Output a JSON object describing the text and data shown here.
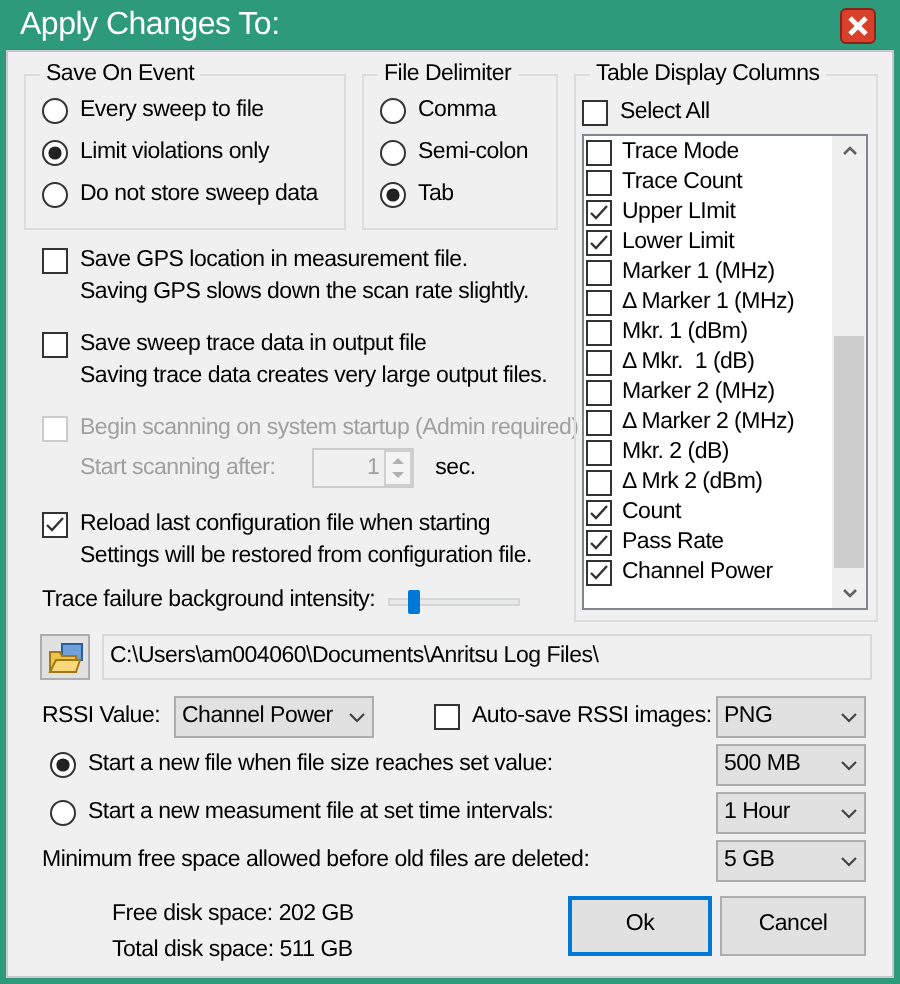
{
  "window": {
    "title": "Apply Changes To:"
  },
  "save_on_event": {
    "label": "Save On Event",
    "options": [
      {
        "label": "Every sweep to file",
        "selected": false
      },
      {
        "label": "Limit violations only",
        "selected": true
      },
      {
        "label": "Do not store sweep data",
        "selected": false
      }
    ]
  },
  "file_delimiter": {
    "label": "File Delimiter",
    "options": [
      {
        "label": "Comma",
        "selected": false
      },
      {
        "label": "Semi-colon",
        "selected": false
      },
      {
        "label": "Tab",
        "selected": true
      }
    ]
  },
  "table_display_columns": {
    "label": "Table Display Columns",
    "select_all": {
      "label": "Select All",
      "checked": false
    },
    "items": [
      {
        "label": "Trace Mode",
        "checked": false
      },
      {
        "label": "Trace Count",
        "checked": false
      },
      {
        "label": "Upper LImit",
        "checked": true
      },
      {
        "label": "Lower Limit",
        "checked": true
      },
      {
        "label": "Marker 1 (MHz)",
        "checked": false
      },
      {
        "label": "Δ Marker 1 (MHz)",
        "checked": false
      },
      {
        "label": "Mkr. 1 (dBm)",
        "checked": false
      },
      {
        "label": "Δ Mkr.  1 (dB)",
        "checked": false
      },
      {
        "label": "Marker 2 (MHz)",
        "checked": false
      },
      {
        "label": "Δ Marker 2 (MHz)",
        "checked": false
      },
      {
        "label": "Mkr. 2 (dB)",
        "checked": false
      },
      {
        "label": "Δ Mrk 2 (dBm)",
        "checked": false
      },
      {
        "label": "Count",
        "checked": true
      },
      {
        "label": "Pass Rate",
        "checked": true
      },
      {
        "label": "Channel Power",
        "checked": true
      }
    ]
  },
  "options": [
    {
      "label": "Save GPS location in measurement file.",
      "note": "Saving GPS slows down the scan rate slightly.",
      "checked": false,
      "disabled": false
    },
    {
      "label": "Save sweep trace data in output file",
      "note": "Saving trace data creates very large output files.",
      "checked": false,
      "disabled": false
    },
    {
      "label": "Begin scanning on system startup (Admin required)",
      "checked": false,
      "disabled": true,
      "delay": {
        "label": "Start scanning after:",
        "value": "1",
        "unit": "sec."
      }
    },
    {
      "label": "Reload last configuration file when starting",
      "note": "Settings will be restored from configuration file.",
      "checked": true,
      "disabled": false
    }
  ],
  "trace_failure_intensity": {
    "label": "Trace failure background intensity:",
    "level": 0.18
  },
  "log_folder": {
    "path": "C:\\Users\\am004060\\Documents\\Anritsu Log Files\\"
  },
  "rssi_value": {
    "label": "RSSI Value:",
    "value": "Channel Power"
  },
  "auto_save_rssi": {
    "label": "Auto-save RSSI images:",
    "checked": false,
    "format": "PNG"
  },
  "file_rotation": [
    {
      "label": "Start a new file when file size reaches set value:",
      "selected": true,
      "value": "500 MB"
    },
    {
      "label": "Start a new measument file at set time intervals:",
      "selected": false,
      "value": "1 Hour"
    }
  ],
  "min_free_space": {
    "label": "Minimum free space allowed before old files are deleted:",
    "value": "5 GB"
  },
  "disk": [
    "Free disk space: 202 GB",
    "Total disk space: 511 GB"
  ],
  "buttons": [
    {
      "label": "Ok",
      "default": true
    },
    {
      "label": "Cancel",
      "default": false
    }
  ]
}
